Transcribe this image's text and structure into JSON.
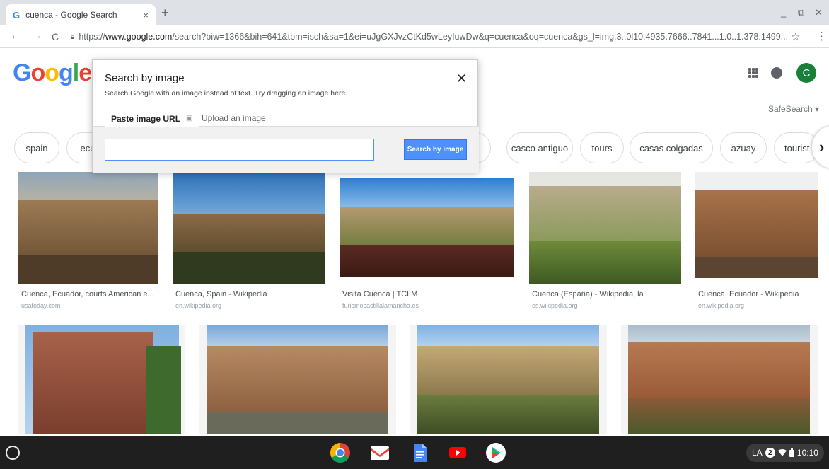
{
  "browser": {
    "tab_title": "cuenca - Google Search",
    "tab_favicon": "G",
    "tab_close": "×",
    "new_tab": "+",
    "url_prefix": "https://",
    "url_host": "www.google.com",
    "url_rest": "/search?biw=1366&bih=641&tbm=isch&sa=1&ei=uJgGXJvzCtKd5wLeyIuwDw&q=cuenca&oq=cuenca&gs_l=img.3..0l10.4935.7666..7841...1.0..1.378.1499...",
    "back": "←",
    "forward": "→",
    "reload": "C",
    "star": "☆",
    "menu": "⋮",
    "minimize": "_",
    "restore": "⧉",
    "close": "✕"
  },
  "header": {
    "logo": [
      "G",
      "o",
      "o",
      "g",
      "l",
      "e"
    ],
    "avatar_letter": "C",
    "safesearch": "SafeSearch ▾"
  },
  "chips": [
    "spain",
    "ecu",
    "casco antiguo",
    "tours",
    "casas colgadas",
    "azuay",
    "tourist"
  ],
  "chip_next": "›",
  "results_row1": [
    {
      "caption": "Cuenca, Ecuador, courts American e...",
      "source": "usatoday.com"
    },
    {
      "caption": "Cuenca, Spain - Wikipedia",
      "source": "en.wikipedia.org"
    },
    {
      "caption": "Visita Cuenca | TCLM",
      "source": "turismocastillalamancha.es"
    },
    {
      "caption": "Cuenca (España) - Wikipedia, la ...",
      "source": "es.wikipedia.org"
    },
    {
      "caption": "Cuenca, Ecuador - Wikipedia",
      "source": "en.wikipedia.org"
    }
  ],
  "dialog": {
    "title": "Search by image",
    "subtitle": "Search Google with an image instead of text. Try dragging an image here.",
    "tab_paste": "Paste image URL",
    "tab_paste_icon": "▣",
    "tab_upload": "Upload an image",
    "input_value": "",
    "search_button": "Search by image",
    "close": "✕"
  },
  "shelf": {
    "status_lang": "LA",
    "status_badge": "2",
    "time": "10:10"
  },
  "colors": {
    "accent_blue": "#4d90fe",
    "google_blue": "#4285f4",
    "google_red": "#ea4335",
    "google_yellow": "#fbbc05",
    "google_green": "#34a853",
    "avatar_green": "#188038"
  },
  "icons": [
    "google-favicon",
    "lock-icon",
    "star-icon",
    "apps-grid-icon",
    "notification-icon",
    "close-icon",
    "image-icon",
    "chevron-right-icon",
    "launcher-icon",
    "chrome-icon",
    "gmail-icon",
    "docs-icon",
    "youtube-icon",
    "play-store-icon",
    "wifi-icon",
    "battery-icon"
  ]
}
